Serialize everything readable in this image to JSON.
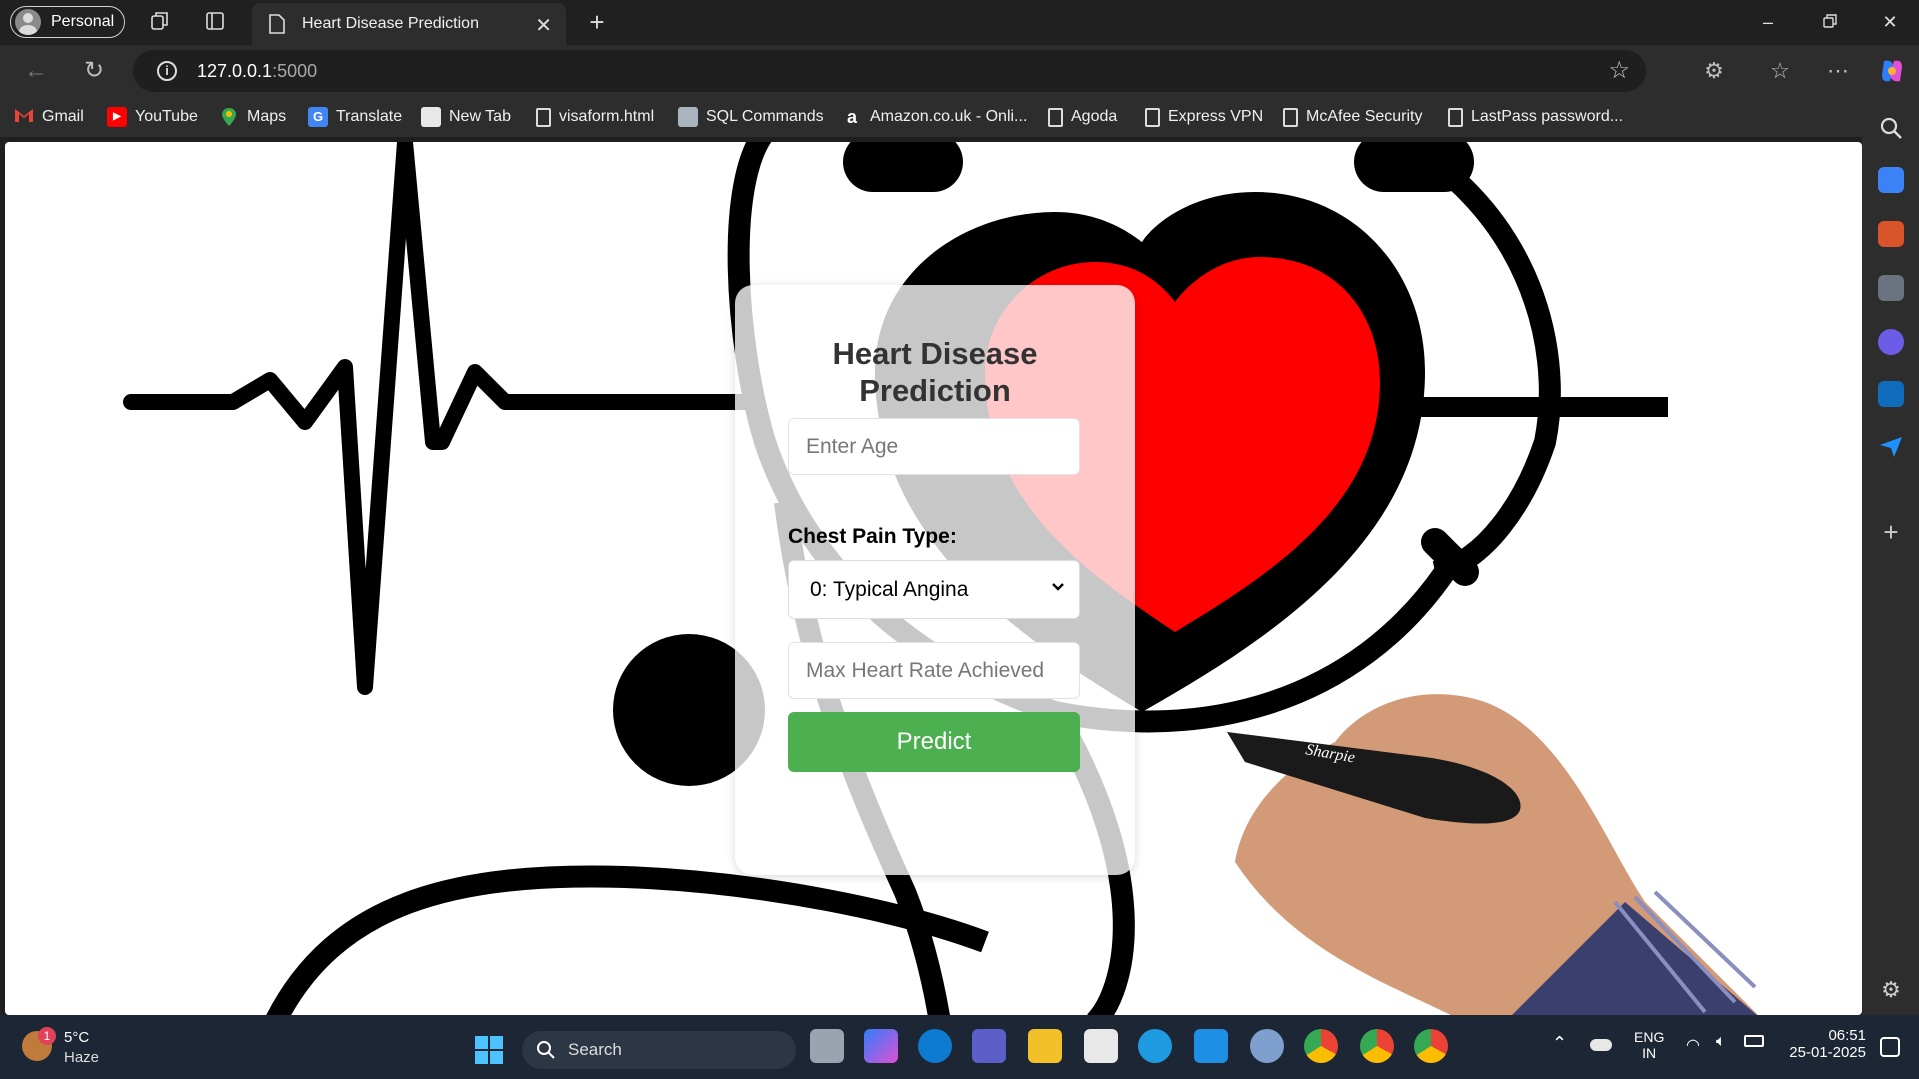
{
  "browser": {
    "profile": "Personal",
    "tab_title": "Heart Disease Prediction",
    "url_host": "127.0.0.1",
    "url_port": ":5000"
  },
  "bookmarks": [
    {
      "label": "Gmail",
      "icon": "gmail-icon",
      "color": "#ea4335"
    },
    {
      "label": "YouTube",
      "icon": "youtube-icon",
      "color": "#ff0000"
    },
    {
      "label": "Maps",
      "icon": "maps-icon",
      "color": "#34a853"
    },
    {
      "label": "Translate",
      "icon": "translate-icon",
      "color": "#4285f4"
    },
    {
      "label": "New Tab",
      "icon": "new-tab-icon",
      "color": "#dddddd"
    },
    {
      "label": "visaform.html",
      "icon": "page-icon",
      "color": "#dddddd"
    },
    {
      "label": "SQL Commands",
      "icon": "sql-icon",
      "color": "#9aa7b3"
    },
    {
      "label": "Amazon.co.uk - Onli...",
      "icon": "amazon-icon",
      "color": "#ff9900"
    },
    {
      "label": "Agoda",
      "icon": "page-icon",
      "color": "#dddddd"
    },
    {
      "label": "Express VPN",
      "icon": "page-icon",
      "color": "#dddddd"
    },
    {
      "label": "McAfee Security",
      "icon": "page-icon",
      "color": "#dddddd"
    },
    {
      "label": "LastPass password...",
      "icon": "page-icon",
      "color": "#dddddd"
    }
  ],
  "form": {
    "title": "Heart Disease Prediction",
    "age_placeholder": "Enter Age",
    "chest_pain_label": "Chest Pain Type:",
    "chest_pain_selected": "0: Typical Angina",
    "max_hr_placeholder": "Max Heart Rate Achieved",
    "predict_label": "Predict",
    "accent": "#4caf50"
  },
  "taskbar": {
    "weather_temp": "5°C",
    "weather_desc": "Haze",
    "weather_badge": "1",
    "search_label": "Search",
    "lang1": "ENG",
    "lang2": "IN",
    "time": "06:51",
    "date": "25-01-2025"
  }
}
